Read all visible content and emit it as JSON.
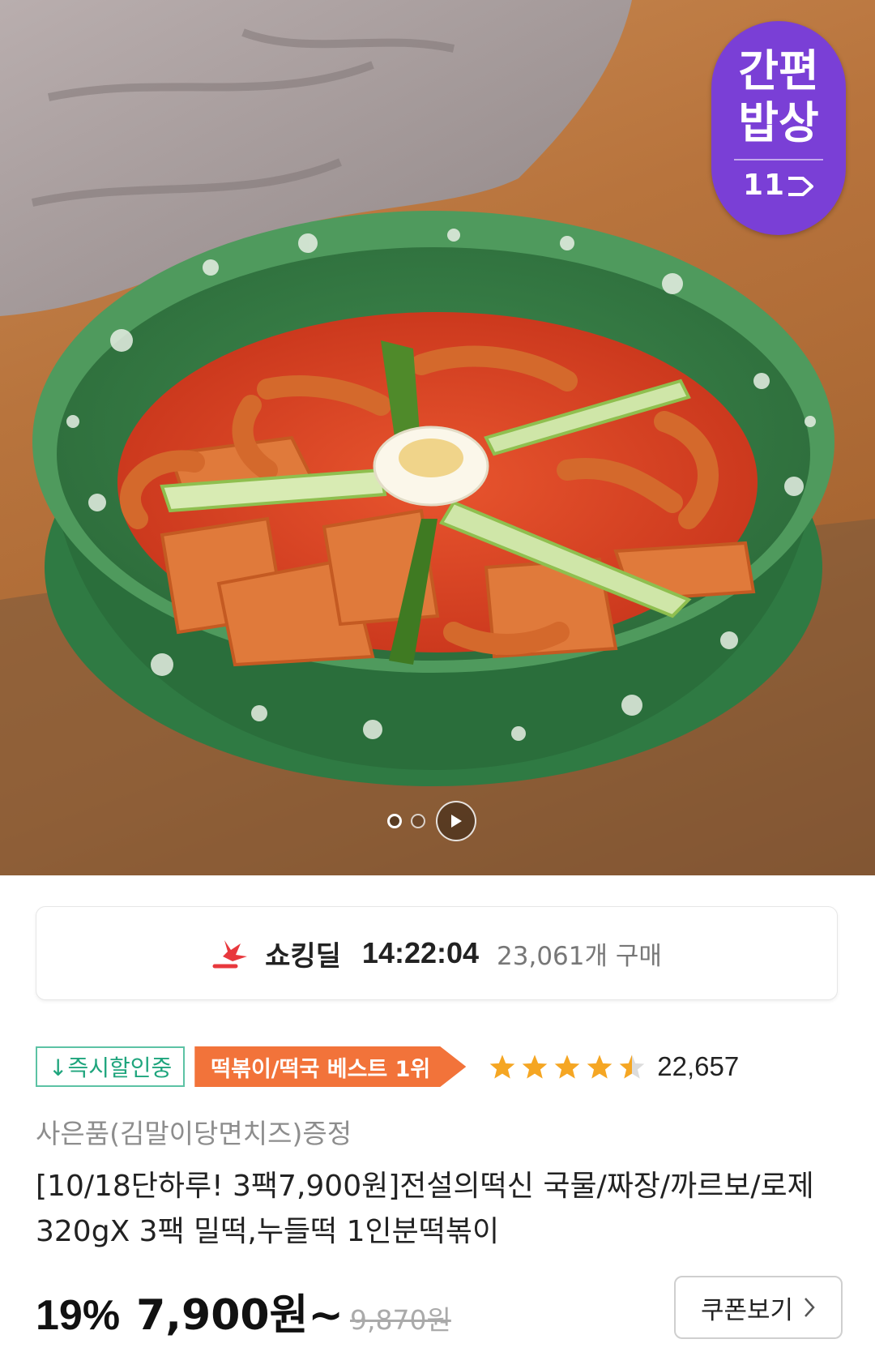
{
  "hero": {
    "badge": {
      "line1": "간편",
      "line2": "밥상",
      "logo": "11"
    },
    "carousel": {
      "total_pages": 2,
      "current_page": 1,
      "play_icon": "play-icon"
    }
  },
  "deal": {
    "icon": "shocking-deal-icon",
    "label": "쇼킹딜",
    "timer": "14:22:04",
    "buyers": "23,061개 구매",
    "accent_color": "#e8383d"
  },
  "tags": {
    "instant_discount": "↓즉시할인중",
    "best_rank": "떡볶이/떡국 베스트 1위",
    "rating_value": 4.5,
    "rating_max": 5,
    "rating_count": "22,657",
    "star_color": "#f5a623",
    "instant_color": "#1fa57d",
    "best_color": "#f2733a"
  },
  "product": {
    "gift": "사은품(김말이당면치즈)증정",
    "title": "[10/18단하루! 3팩7,900원]전설의떡신 국물/짜장/까르보/로제 320gX 3팩  밀떡,누들떡 1인분떡볶이"
  },
  "price": {
    "discount": "19%",
    "sale": "7,900원~",
    "original": "9,870원",
    "coupon_label": "쿠폰보기",
    "coupon_icon": "chevron-right-icon"
  }
}
